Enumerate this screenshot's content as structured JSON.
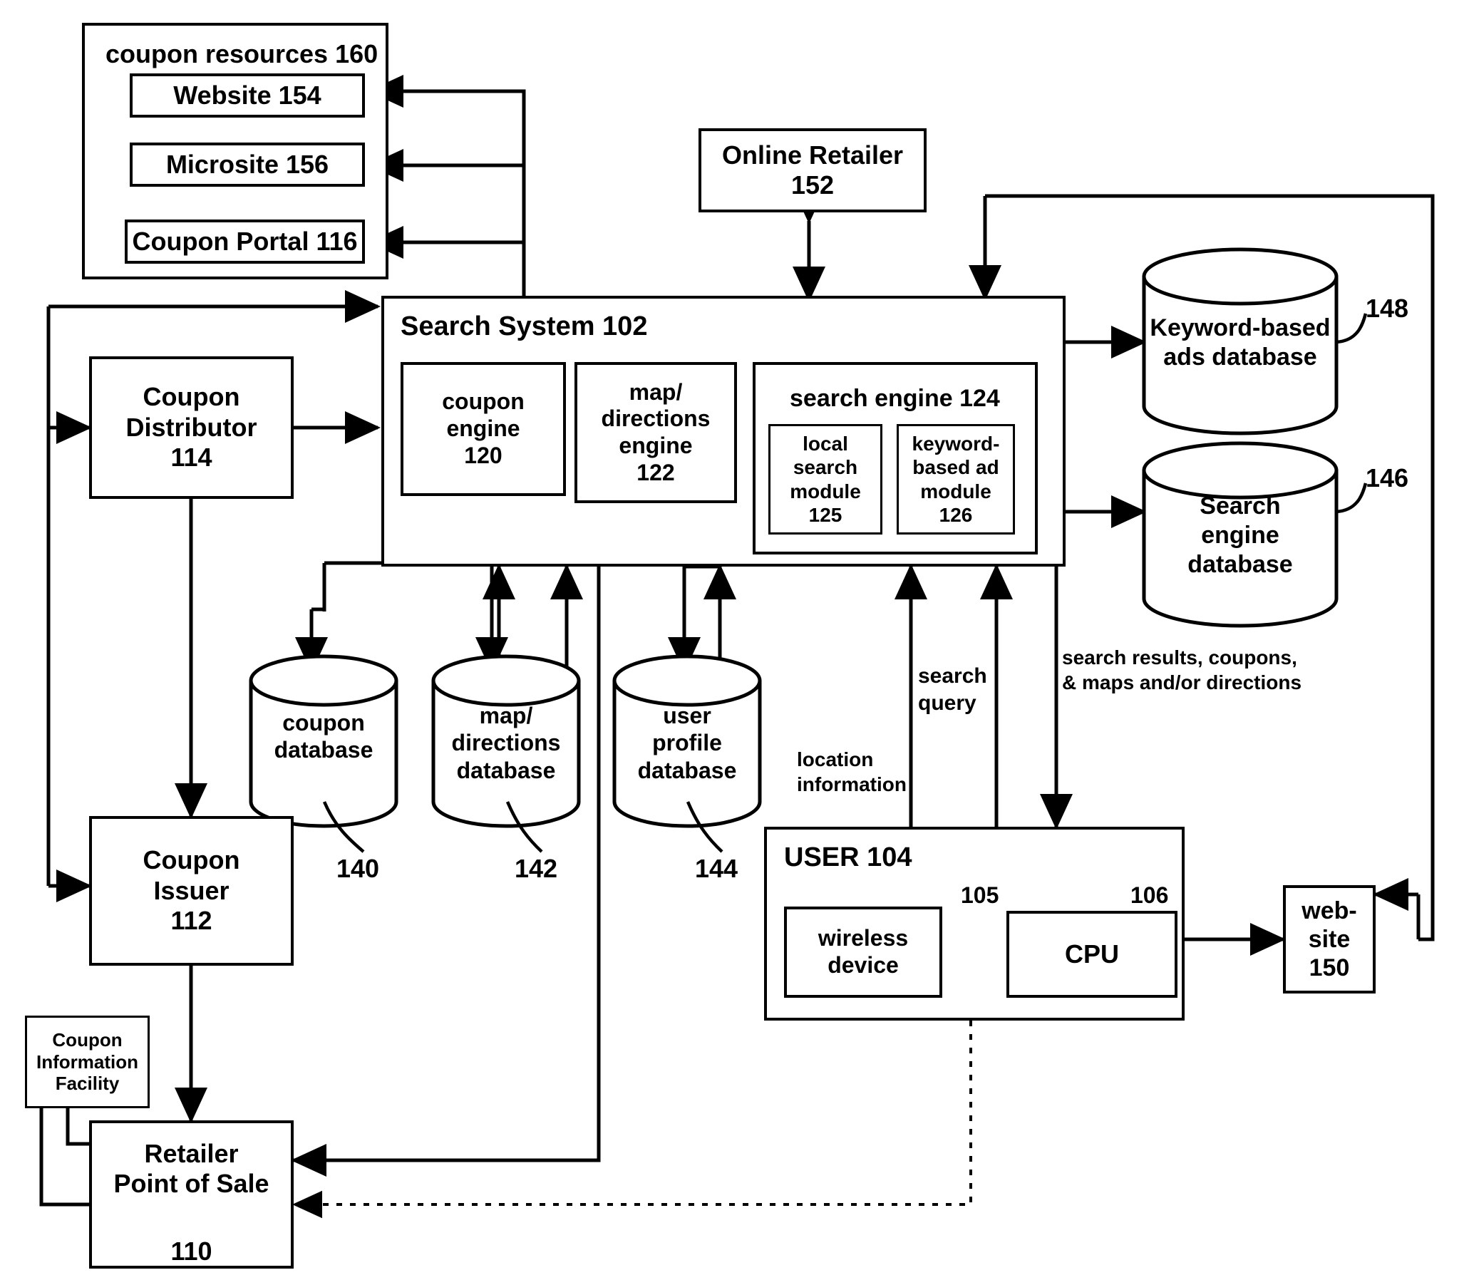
{
  "figure": {
    "type": "patent-system-architecture-block-diagram",
    "background_color": "#ffffff",
    "line_color": "#000000"
  },
  "groups": {
    "coupon_resources": {
      "label": "coupon resources 160",
      "items": [
        {
          "label": "Website 154"
        },
        {
          "label": "Microsite 156"
        },
        {
          "label": "Coupon Portal 116"
        }
      ]
    },
    "search_system": {
      "label": "Search System 102",
      "engines": [
        {
          "label": "coupon\nengine\n120"
        },
        {
          "label": "map/\ndirections\nengine\n122"
        }
      ],
      "search_engine": {
        "label": "search engine 124",
        "modules": [
          {
            "label": "local\nsearch\nmodule\n125"
          },
          {
            "label": "keyword-\nbased ad\nmodule\n126"
          }
        ]
      }
    },
    "user": {
      "label": "USER 104",
      "components": [
        {
          "label": "wireless\ndevice",
          "ref": "105"
        },
        {
          "label": "CPU",
          "ref": "106"
        }
      ]
    }
  },
  "boxes": {
    "online_retailer": "Online Retailer\n152",
    "coupon_distributor": "Coupon\nDistributor\n114",
    "coupon_issuer": "Coupon\nIssuer\n112",
    "coupon_information_facility": "Coupon\nInformation\nFacility",
    "retailer_point_of_sale": "Retailer\nPoint of Sale",
    "retailer_point_of_sale_ref": "110",
    "website": "web-\nsite\n150"
  },
  "cylinders": {
    "keyword_ads_db": {
      "label": "Keyword-based\nads database",
      "ref": "148"
    },
    "search_engine_db": {
      "label": "Search\nengine\ndatabase",
      "ref": "146"
    },
    "coupon_db": {
      "label": "coupon\ndatabase",
      "ref": "140"
    },
    "map_directions_db": {
      "label": "map/\ndirections\ndatabase",
      "ref": "142"
    },
    "user_profile_db": {
      "label": "user\nprofile\ndatabase",
      "ref": "144"
    }
  },
  "annotations": {
    "location_information": "location\ninformation",
    "search_query": "search\nquery",
    "search_results": "search results, coupons,\n& maps and/or directions"
  }
}
